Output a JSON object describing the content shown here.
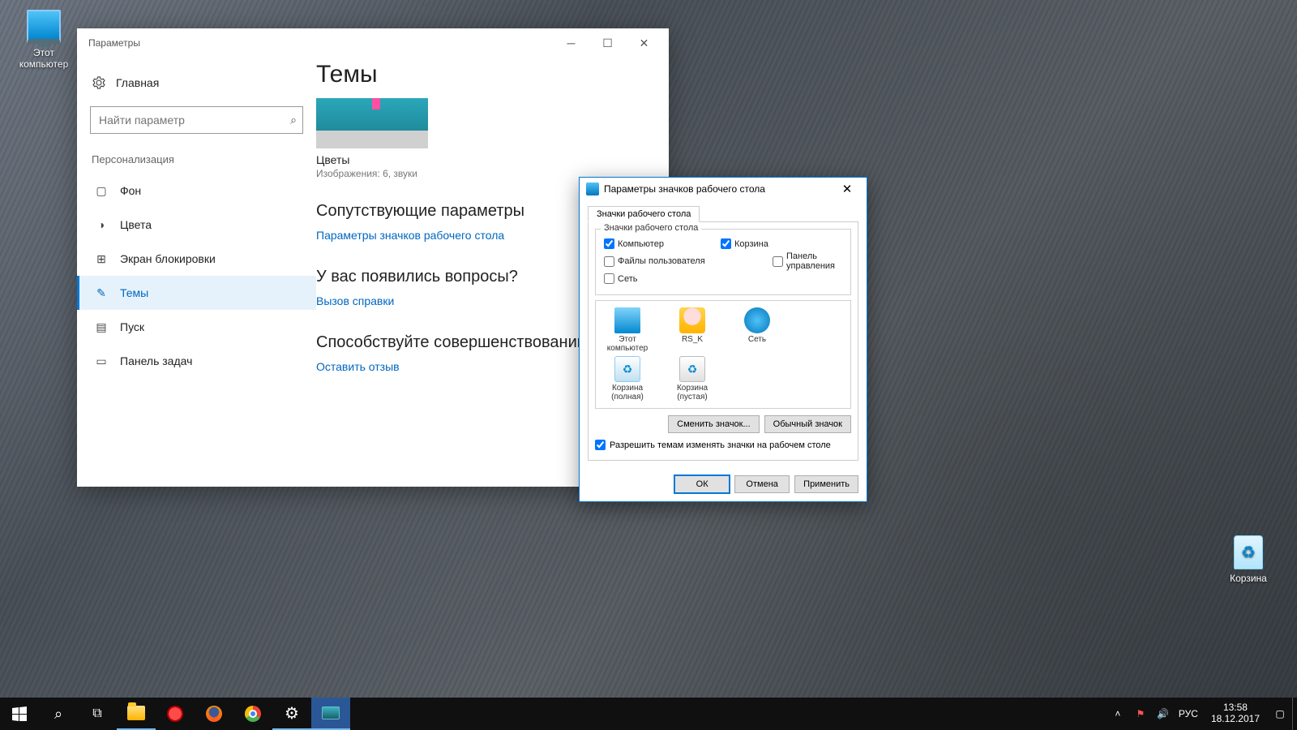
{
  "desktop": {
    "thispc": "Этот компьютер",
    "recycle": "Корзина"
  },
  "settings": {
    "title": "Параметры",
    "home": "Главная",
    "search_placeholder": "Найти параметр",
    "section": "Персонализация",
    "nav": {
      "background": "Фон",
      "colors": "Цвета",
      "lockscreen": "Экран блокировки",
      "themes": "Темы",
      "start": "Пуск",
      "taskbar": "Панель задач"
    },
    "main": {
      "heading": "Темы",
      "theme_name": "Цветы",
      "theme_sub": "Изображения: 6, звуки",
      "related_heading": "Сопутствующие параметры",
      "related_link": "Параметры значков рабочего стола",
      "help_heading": "У вас появились вопросы?",
      "help_link": "Вызов справки",
      "feedback_heading": "Способствуйте совершенствованию",
      "feedback_link": "Оставить отзыв"
    }
  },
  "dialog": {
    "title": "Параметры значков рабочего стола",
    "tab": "Значки рабочего стола",
    "group": "Значки рабочего стола",
    "cb_computer": "Компьютер",
    "cb_recycle": "Корзина",
    "cb_userfiles": "Файлы пользователя",
    "cb_cpanel": "Панель управления",
    "cb_network": "Сеть",
    "icons": {
      "thispc": "Этот компьютер",
      "user": "RS_K",
      "network": "Сеть",
      "bin_full": "Корзина (полная)",
      "bin_empty": "Корзина (пустая)"
    },
    "btn_change": "Сменить значок...",
    "btn_default": "Обычный значок",
    "allow": "Разрешить темам изменять значки на рабочем столе",
    "ok": "ОК",
    "cancel": "Отмена",
    "apply": "Применить"
  },
  "taskbar": {
    "lang": "РУС",
    "time": "13:58",
    "date": "18.12.2017"
  }
}
